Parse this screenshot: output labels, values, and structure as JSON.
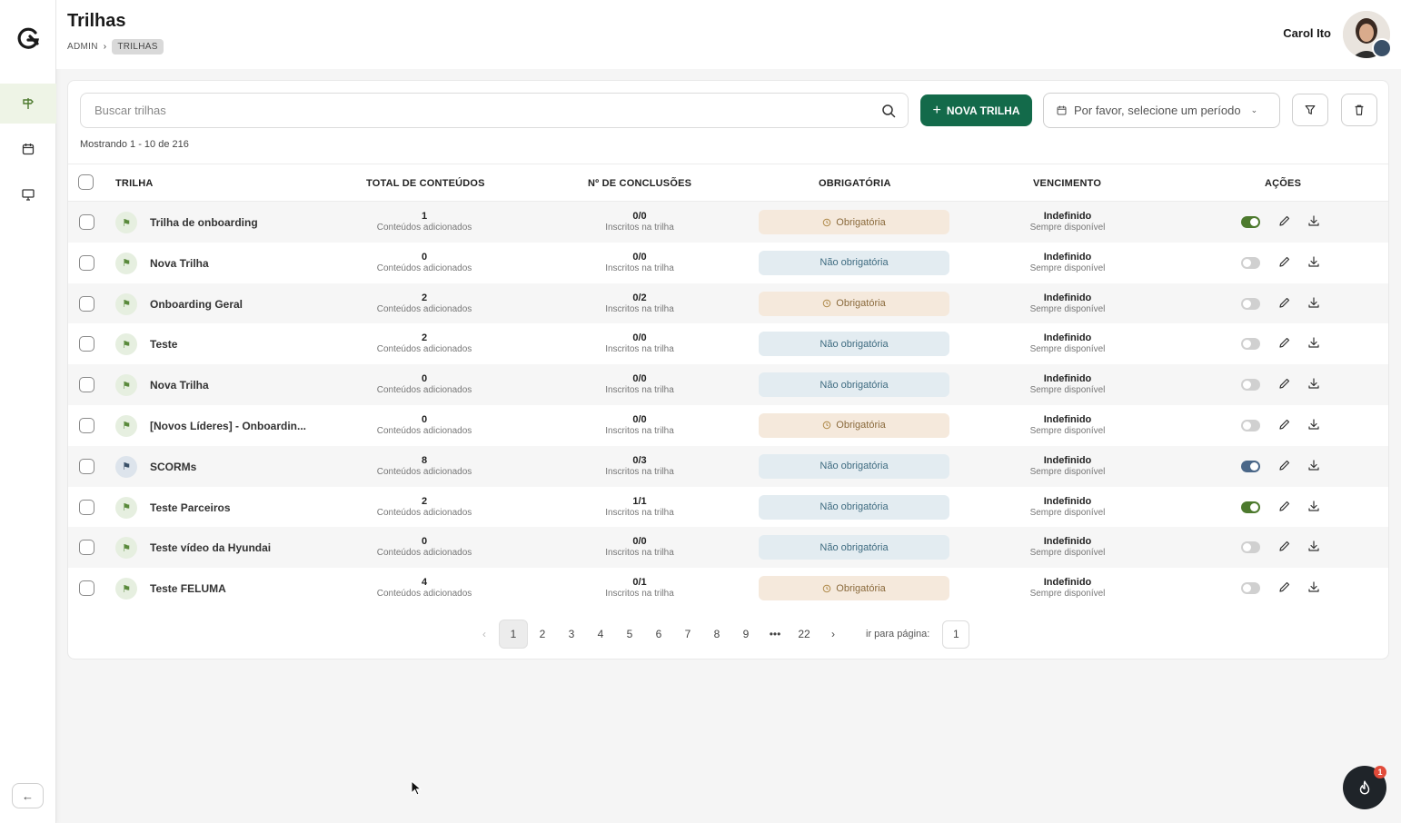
{
  "header": {
    "title": "Trilhas",
    "breadcrumb": [
      "ADMIN",
      "TRILHAS"
    ],
    "user_name": "Carol Ito"
  },
  "sidebar": {
    "items": [
      {
        "icon": "signpost-icon",
        "active": true
      },
      {
        "icon": "calendar-icon",
        "active": false
      },
      {
        "icon": "monitor-icon",
        "active": false
      }
    ],
    "collapse_icon": "arrow-left-icon"
  },
  "toolbar": {
    "search_placeholder": "Buscar trilhas",
    "new_button_label": "NOVA TRILHA",
    "period_placeholder": "Por favor, selecione um período",
    "showing_text": "Mostrando 1 - 10 de 216"
  },
  "table": {
    "columns": [
      "TRILHA",
      "TOTAL DE CONTEÚDOS",
      "Nº DE CONCLUSÕES",
      "OBRIGATÓRIA",
      "VENCIMENTO",
      "AÇÕES"
    ],
    "rows": [
      {
        "name": "Trilha de onboarding",
        "contents": "1",
        "contents_sub": "Conteúdos adicionados",
        "completions": "0/0",
        "completions_sub": "Inscritos na trilha",
        "mandatory": "Obrigatória",
        "mandatory_type": "req",
        "due": "Indefinido",
        "due_sub": "Sempre disponível",
        "active": "on",
        "icon_color": "green"
      },
      {
        "name": "Nova Trilha",
        "contents": "0",
        "contents_sub": "Conteúdos adicionados",
        "completions": "0/0",
        "completions_sub": "Inscritos na trilha",
        "mandatory": "Não obrigatória",
        "mandatory_type": "nreq",
        "due": "Indefinido",
        "due_sub": "Sempre disponível",
        "active": "off",
        "icon_color": "green"
      },
      {
        "name": "Onboarding Geral",
        "contents": "2",
        "contents_sub": "Conteúdos adicionados",
        "completions": "0/2",
        "completions_sub": "Inscritos na trilha",
        "mandatory": "Obrigatória",
        "mandatory_type": "req",
        "due": "Indefinido",
        "due_sub": "Sempre disponível",
        "active": "off",
        "icon_color": "green"
      },
      {
        "name": "Teste",
        "contents": "2",
        "contents_sub": "Conteúdos adicionados",
        "completions": "0/0",
        "completions_sub": "Inscritos na trilha",
        "mandatory": "Não obrigatória",
        "mandatory_type": "nreq",
        "due": "Indefinido",
        "due_sub": "Sempre disponível",
        "active": "off",
        "icon_color": "green"
      },
      {
        "name": "Nova Trilha",
        "contents": "0",
        "contents_sub": "Conteúdos adicionados",
        "completions": "0/0",
        "completions_sub": "Inscritos na trilha",
        "mandatory": "Não obrigatória",
        "mandatory_type": "nreq",
        "due": "Indefinido",
        "due_sub": "Sempre disponível",
        "active": "off",
        "icon_color": "green"
      },
      {
        "name": "[Novos Líderes] - Onboardin...",
        "contents": "0",
        "contents_sub": "Conteúdos adicionados",
        "completions": "0/0",
        "completions_sub": "Inscritos na trilha",
        "mandatory": "Obrigatória",
        "mandatory_type": "req",
        "due": "Indefinido",
        "due_sub": "Sempre disponível",
        "active": "off",
        "icon_color": "green"
      },
      {
        "name": "SCORMs",
        "contents": "8",
        "contents_sub": "Conteúdos adicionados",
        "completions": "0/3",
        "completions_sub": "Inscritos na trilha",
        "mandatory": "Não obrigatória",
        "mandatory_type": "nreq",
        "due": "Indefinido",
        "due_sub": "Sempre disponível",
        "active": "blue",
        "icon_color": "blue"
      },
      {
        "name": "Teste Parceiros",
        "contents": "2",
        "contents_sub": "Conteúdos adicionados",
        "completions": "1/1",
        "completions_sub": "Inscritos na trilha",
        "mandatory": "Não obrigatória",
        "mandatory_type": "nreq",
        "due": "Indefinido",
        "due_sub": "Sempre disponível",
        "active": "on",
        "icon_color": "green"
      },
      {
        "name": "Teste vídeo da Hyundai",
        "contents": "0",
        "contents_sub": "Conteúdos adicionados",
        "completions": "0/0",
        "completions_sub": "Inscritos na trilha",
        "mandatory": "Não obrigatória",
        "mandatory_type": "nreq",
        "due": "Indefinido",
        "due_sub": "Sempre disponível",
        "active": "off",
        "icon_color": "green"
      },
      {
        "name": "Teste FELUMA",
        "contents": "4",
        "contents_sub": "Conteúdos adicionados",
        "completions": "0/1",
        "completions_sub": "Inscritos na trilha",
        "mandatory": "Obrigatória",
        "mandatory_type": "req",
        "due": "Indefinido",
        "due_sub": "Sempre disponível",
        "active": "off",
        "icon_color": "green"
      }
    ]
  },
  "pagination": {
    "pages": [
      "1",
      "2",
      "3",
      "4",
      "5",
      "6",
      "7",
      "8",
      "9",
      "•••",
      "22"
    ],
    "current": "1",
    "goto_label": "ir para página:",
    "goto_value": "1"
  },
  "fab": {
    "badge": "1"
  },
  "colors": {
    "primary": "#136a4a",
    "toggle_on": "#4d7a2e",
    "required_bg": "#f5e9dc",
    "not_required_bg": "#e3ecf1"
  }
}
